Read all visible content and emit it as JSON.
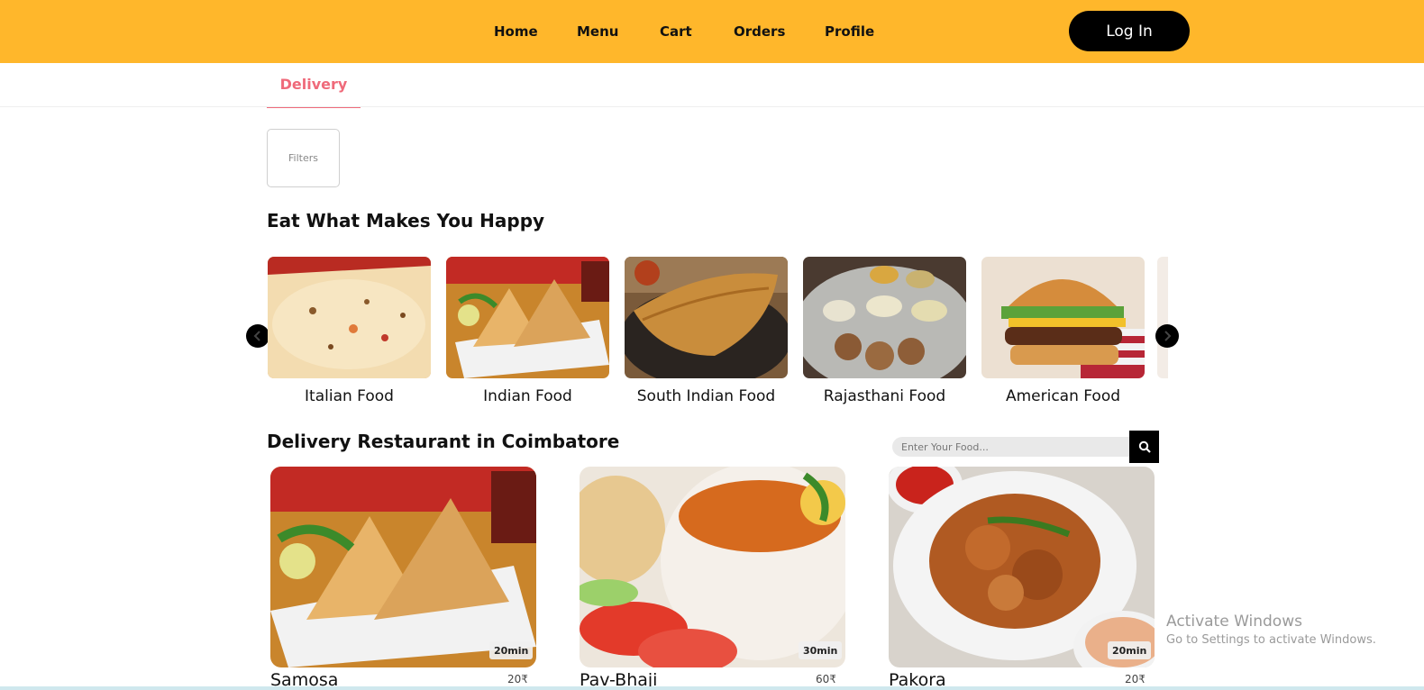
{
  "header": {
    "nav": [
      "Home",
      "Menu",
      "Cart",
      "Orders",
      "Profile"
    ],
    "login_label": "Log In",
    "bg_color": "#FFB72B"
  },
  "tabs": {
    "active": "Delivery",
    "accent_color": "#EF6A7A"
  },
  "filters_label": "Filters",
  "categories_section": {
    "title": "Eat What Makes You Happy",
    "items": [
      {
        "label": "Italian Food",
        "image": "pizza-slice-photo"
      },
      {
        "label": "Indian Food",
        "image": "samosa-photo"
      },
      {
        "label": "South Indian Food",
        "image": "dosa-photo"
      },
      {
        "label": "Rajasthani Food",
        "image": "thali-photo"
      },
      {
        "label": "American Food",
        "image": "burger-photo"
      }
    ],
    "prev_icon": "chevron-left-icon",
    "next_icon": "chevron-right-icon"
  },
  "restaurants_section": {
    "title": "Delivery Restaurant in Coimbatore",
    "search_placeholder": "Enter Your Food...",
    "search_icon": "search-icon",
    "items": [
      {
        "name": "Samosa",
        "price": "20₹",
        "time": "20min",
        "image": "samosa-photo"
      },
      {
        "name": "Pav-Bhaji",
        "price": "60₹",
        "time": "30min",
        "image": "pav-bhaji-photo"
      },
      {
        "name": "Pakora",
        "price": "20₹",
        "time": "20min",
        "image": "pakora-photo"
      }
    ]
  },
  "watermark": {
    "title": "Activate Windows",
    "subtitle": "Go to Settings to activate Windows."
  }
}
